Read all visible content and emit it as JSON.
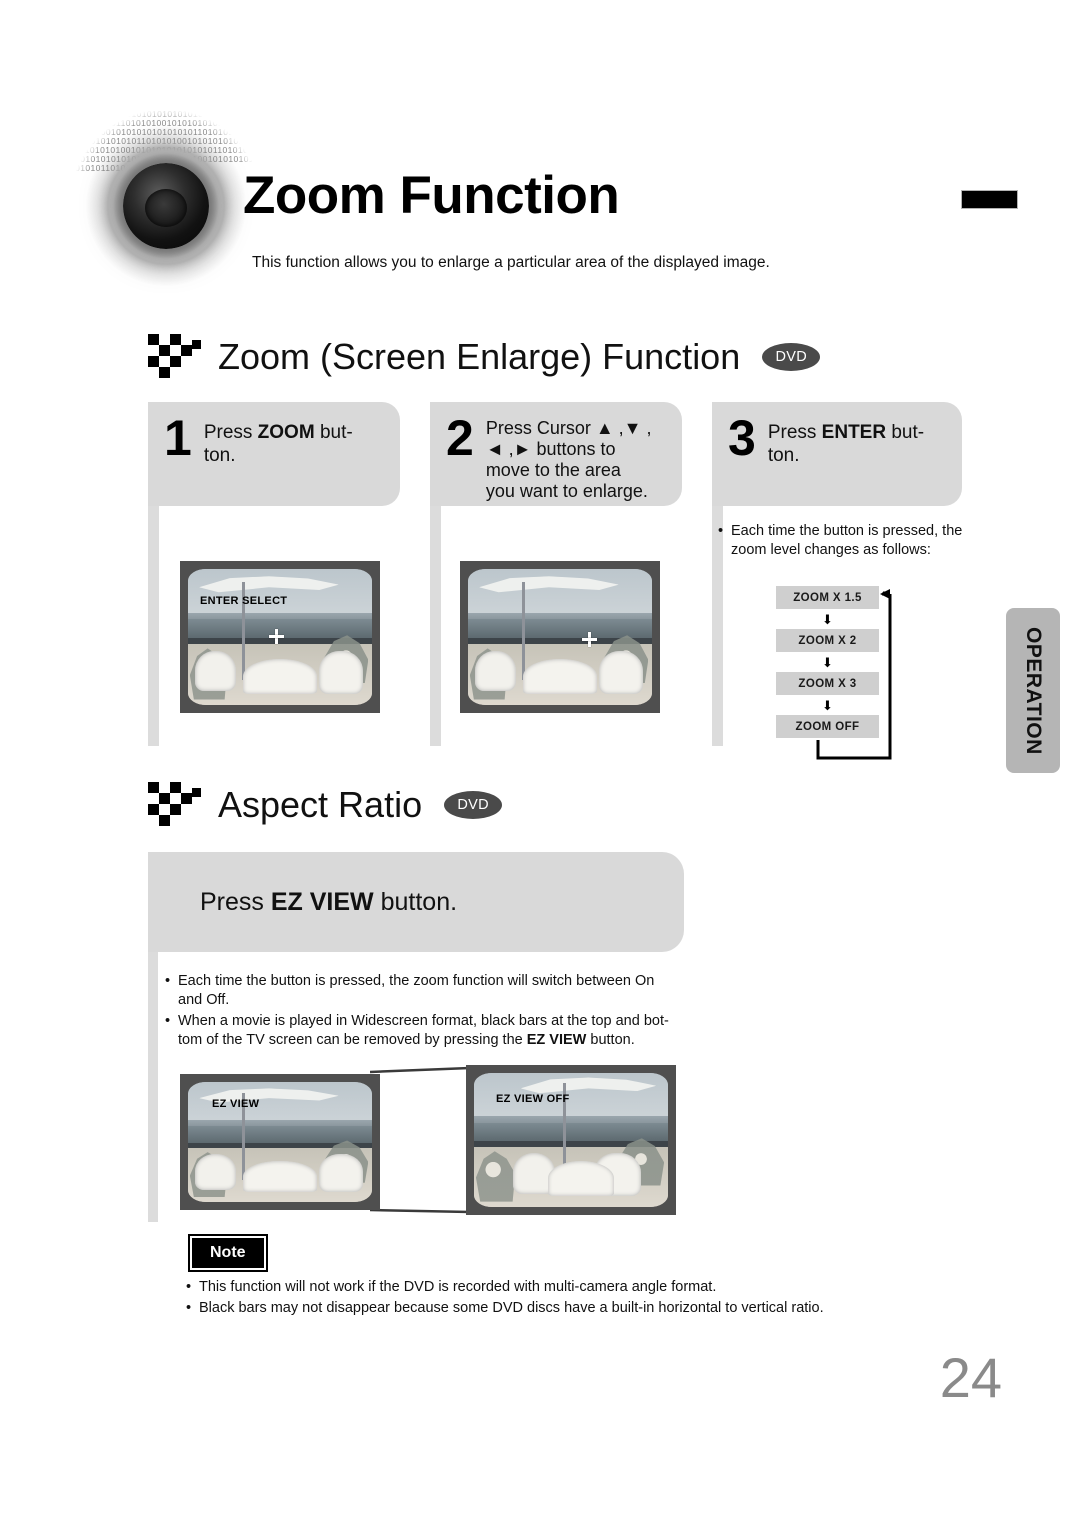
{
  "document": {
    "title": "Zoom Function",
    "intro": "This function allows you to enlarge a particular area of the displayed image.",
    "page_number": "24",
    "side_tab": "OPERATION"
  },
  "section_zoom": {
    "heading": "Zoom (Screen Enlarge) Function",
    "badge": "DVD",
    "steps": [
      {
        "number": "1",
        "text_before": "Press ",
        "bold": "ZOOM",
        "text_after": " but-ton."
      },
      {
        "number": "2",
        "text_before": "Press Cursor ",
        "bold": "",
        "text_after": ""
      },
      {
        "number": "3",
        "text_before": "Press ",
        "bold": "ENTER",
        "text_after": " but-ton."
      }
    ],
    "step1_line1": "Press ZOOM but-",
    "step1_line2": "ton.",
    "step2_line1": "Press Cursor ▲ ,▼ ,",
    "step2_line2": "◄ ,► buttons to",
    "step2_line3": "move to the area",
    "step2_line4": "you want to enlarge.",
    "step3_line1": "Press ENTER but-",
    "step3_line2": "ton.",
    "note_line1": "Each time the button is pressed, the",
    "note_line2": "zoom level changes as follows:",
    "zoom_levels": [
      "ZOOM X 1.5",
      "ZOOM X 2",
      "ZOOM X 3",
      "ZOOM OFF"
    ],
    "tv1_osd": "ENTER SELECT",
    "tv2_osd": ""
  },
  "section_aspect": {
    "heading": "Aspect Ratio",
    "badge": "DVD",
    "banner_before": "Press ",
    "banner_bold": "EZ VIEW",
    "banner_after": " button.",
    "bullets": [
      {
        "line1": "Each time the button is pressed, the zoom function will switch between On",
        "line2": "and Off."
      },
      {
        "line1": "When a movie is played in Widescreen format, black bars at the top and bot-",
        "line2_before": "tom of the TV screen can be removed by pressing the ",
        "line2_bold": "EZ VIEW",
        "line2_after": " button."
      }
    ],
    "tv_left_osd": "EZ VIEW",
    "tv_right_osd": "EZ VIEW OFF"
  },
  "note": {
    "label": "Note",
    "items": [
      "This function will not work if the DVD is recorded with multi-camera angle format.",
      "Black bars may not disappear because some DVD discs have a built-in horizontal to vertical ratio."
    ]
  },
  "colors": {
    "step_box": "#d9d9d9",
    "flow_item": "#cfcfcf",
    "side_tab": "#b5b5b5",
    "badge": "#4a4a4a",
    "page_number": "#8a8a8a"
  }
}
